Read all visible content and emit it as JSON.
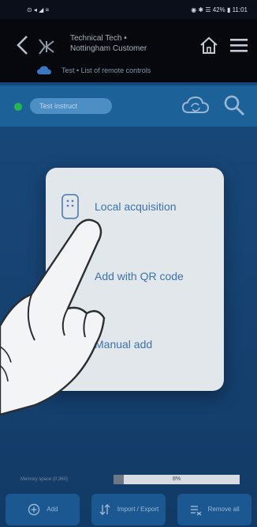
{
  "status_bar": {
    "left_indicators": "⊙ ◂ ◢ ≡",
    "right_indicators": "◉ ✱ ☰ 42% ▮ 11:01"
  },
  "header": {
    "title_line1": "Technical Tech •",
    "title_line2": "Nottingham Customer",
    "subtitle": "Test • List of remote controls"
  },
  "filter": {
    "pill_label": "Test instruct"
  },
  "popup": {
    "items": [
      {
        "label": "Local acquisition",
        "icon": "remote-icon"
      },
      {
        "label": "Add with QR code",
        "icon": "qr-code-icon"
      },
      {
        "label": "Manual add",
        "icon": "pencil-icon"
      }
    ]
  },
  "storage": {
    "label": "Memory space (0,360)",
    "percent_text": "8%",
    "fill_fraction": 0.08
  },
  "bottom_buttons": [
    {
      "label": "Add",
      "icon": "add-circle-icon"
    },
    {
      "label": "Import / Export",
      "icon": "import-export-icon"
    },
    {
      "label": "Remove all",
      "icon": "remove-list-icon"
    }
  ],
  "colors": {
    "accent": "#3e72a8",
    "status_green": "#27b552",
    "header_bg": "#06080d",
    "main_bg": "#174474"
  }
}
